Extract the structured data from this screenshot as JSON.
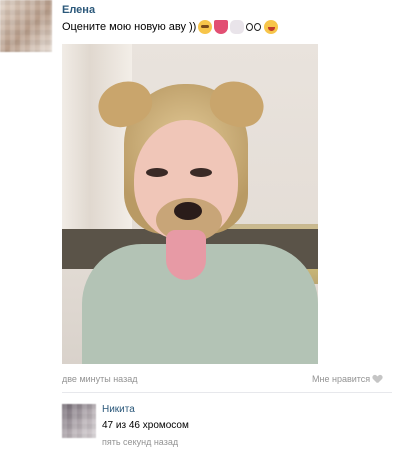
{
  "post": {
    "author": "Елена",
    "text": "Оцените мою новую аву ))",
    "emojis": [
      "anxious-face-emoji",
      "mouth-emoji",
      "bunny-emoji",
      "eyes-emoji",
      "wink-face-emoji"
    ],
    "time": "две минуты назад",
    "like_label": "Мне нравится"
  },
  "comment": {
    "author": "Никита",
    "text": "47 из 46 хромосом",
    "time": "пять секунд назад"
  },
  "colors": {
    "link": "#2b587a",
    "meta": "#939393",
    "divider": "#e7e8ec"
  }
}
